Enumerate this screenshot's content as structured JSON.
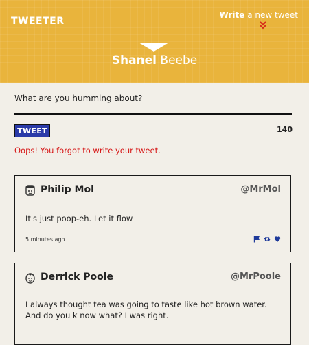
{
  "header": {
    "logo": "TWEETER",
    "write_link": {
      "bold": "Write",
      "rest": " a new tweet"
    },
    "user": {
      "first": "Shanel",
      "last": "Beebe"
    },
    "accent_color": "#e9b43c"
  },
  "compose": {
    "prompt": "What are you humming about?",
    "button_label": "TWEET",
    "counter": "140",
    "error": "Oops! You forgot to write your tweet."
  },
  "tweets": [
    {
      "name": "Philip Mol",
      "handle": "@MrMol",
      "text": "It's just poop-eh. Let it flow",
      "time": "5 minutes ago",
      "avatar_icon": "avatar-icon",
      "actions": [
        "flag-icon",
        "retweet-icon",
        "heart-icon"
      ]
    },
    {
      "name": "Derrick Poole",
      "handle": "@MrPoole",
      "text": "I always thought tea was going to taste like hot brown water. And do you k now what? I was right.",
      "avatar_icon": "avatar-icon"
    }
  ]
}
